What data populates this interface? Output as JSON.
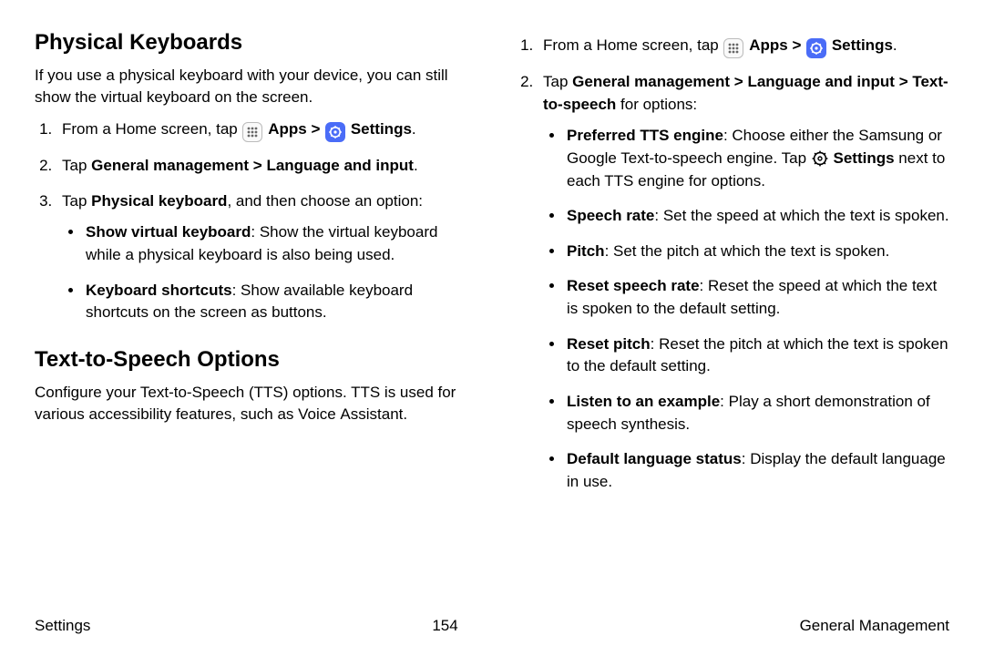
{
  "left": {
    "h1": "Physical Keyboards",
    "intro": "If you use a physical keyboard with your device, you can still show the virtual keyboard on the screen.",
    "step1_a": "From a Home screen, tap ",
    "apps": "Apps",
    "chev": ">",
    "settings": "Settings",
    "period": ".",
    "step2_a": "Tap ",
    "step2_b": "General management",
    "step2_c": "Language and input",
    "step3_a": "Tap ",
    "step3_b": "Physical keyboard",
    "step3_c": ", and then choose an option:",
    "b1_t": "Show virtual keyboard",
    "b1_d": ": Show the virtual keyboard while a physical keyboard is also being used.",
    "b2_t": "Keyboard shortcuts",
    "b2_d": ": Show available keyboard shortcuts on the screen as buttons.",
    "h2": "Text-to-Speech Options",
    "tts_intro": "Configure your Text-to-Speech (TTS) options. TTS is used for various accessibility features, such as Voice Assistant."
  },
  "right": {
    "step1_a": "From a Home screen, tap ",
    "apps": "Apps",
    "chev": ">",
    "settings": "Settings",
    "period": ".",
    "step2_a": "Tap ",
    "step2_b": "General management",
    "step2_c": "Language and input",
    "step2_d": "Text-to-speech",
    "step2_e": " for options:",
    "b1_t": "Preferred TTS engine",
    "b1_d1": ": Choose either the Samsung or Google Text-to-speech engine. Tap ",
    "b1_d2": "Settings",
    "b1_d3": " next to each TTS engine for options.",
    "b2_t": "Speech rate",
    "b2_d": ": Set the speed at which the text is spoken.",
    "b3_t": "Pitch",
    "b3_d": ": Set the pitch at which the text is spoken.",
    "b4_t": "Reset speech rate",
    "b4_d": ": Reset the speed at which the text is spoken to the default setting.",
    "b5_t": "Reset pitch",
    "b5_d": ": Reset the pitch at which the text is spoken to the default setting.",
    "b6_t": "Listen to an example",
    "b6_d": ": Play a short demonstration of speech synthesis.",
    "b7_t": "Default language status",
    "b7_d": ": Display the default language in use."
  },
  "footer": {
    "left": "Settings",
    "center": "154",
    "right": "General Management"
  }
}
